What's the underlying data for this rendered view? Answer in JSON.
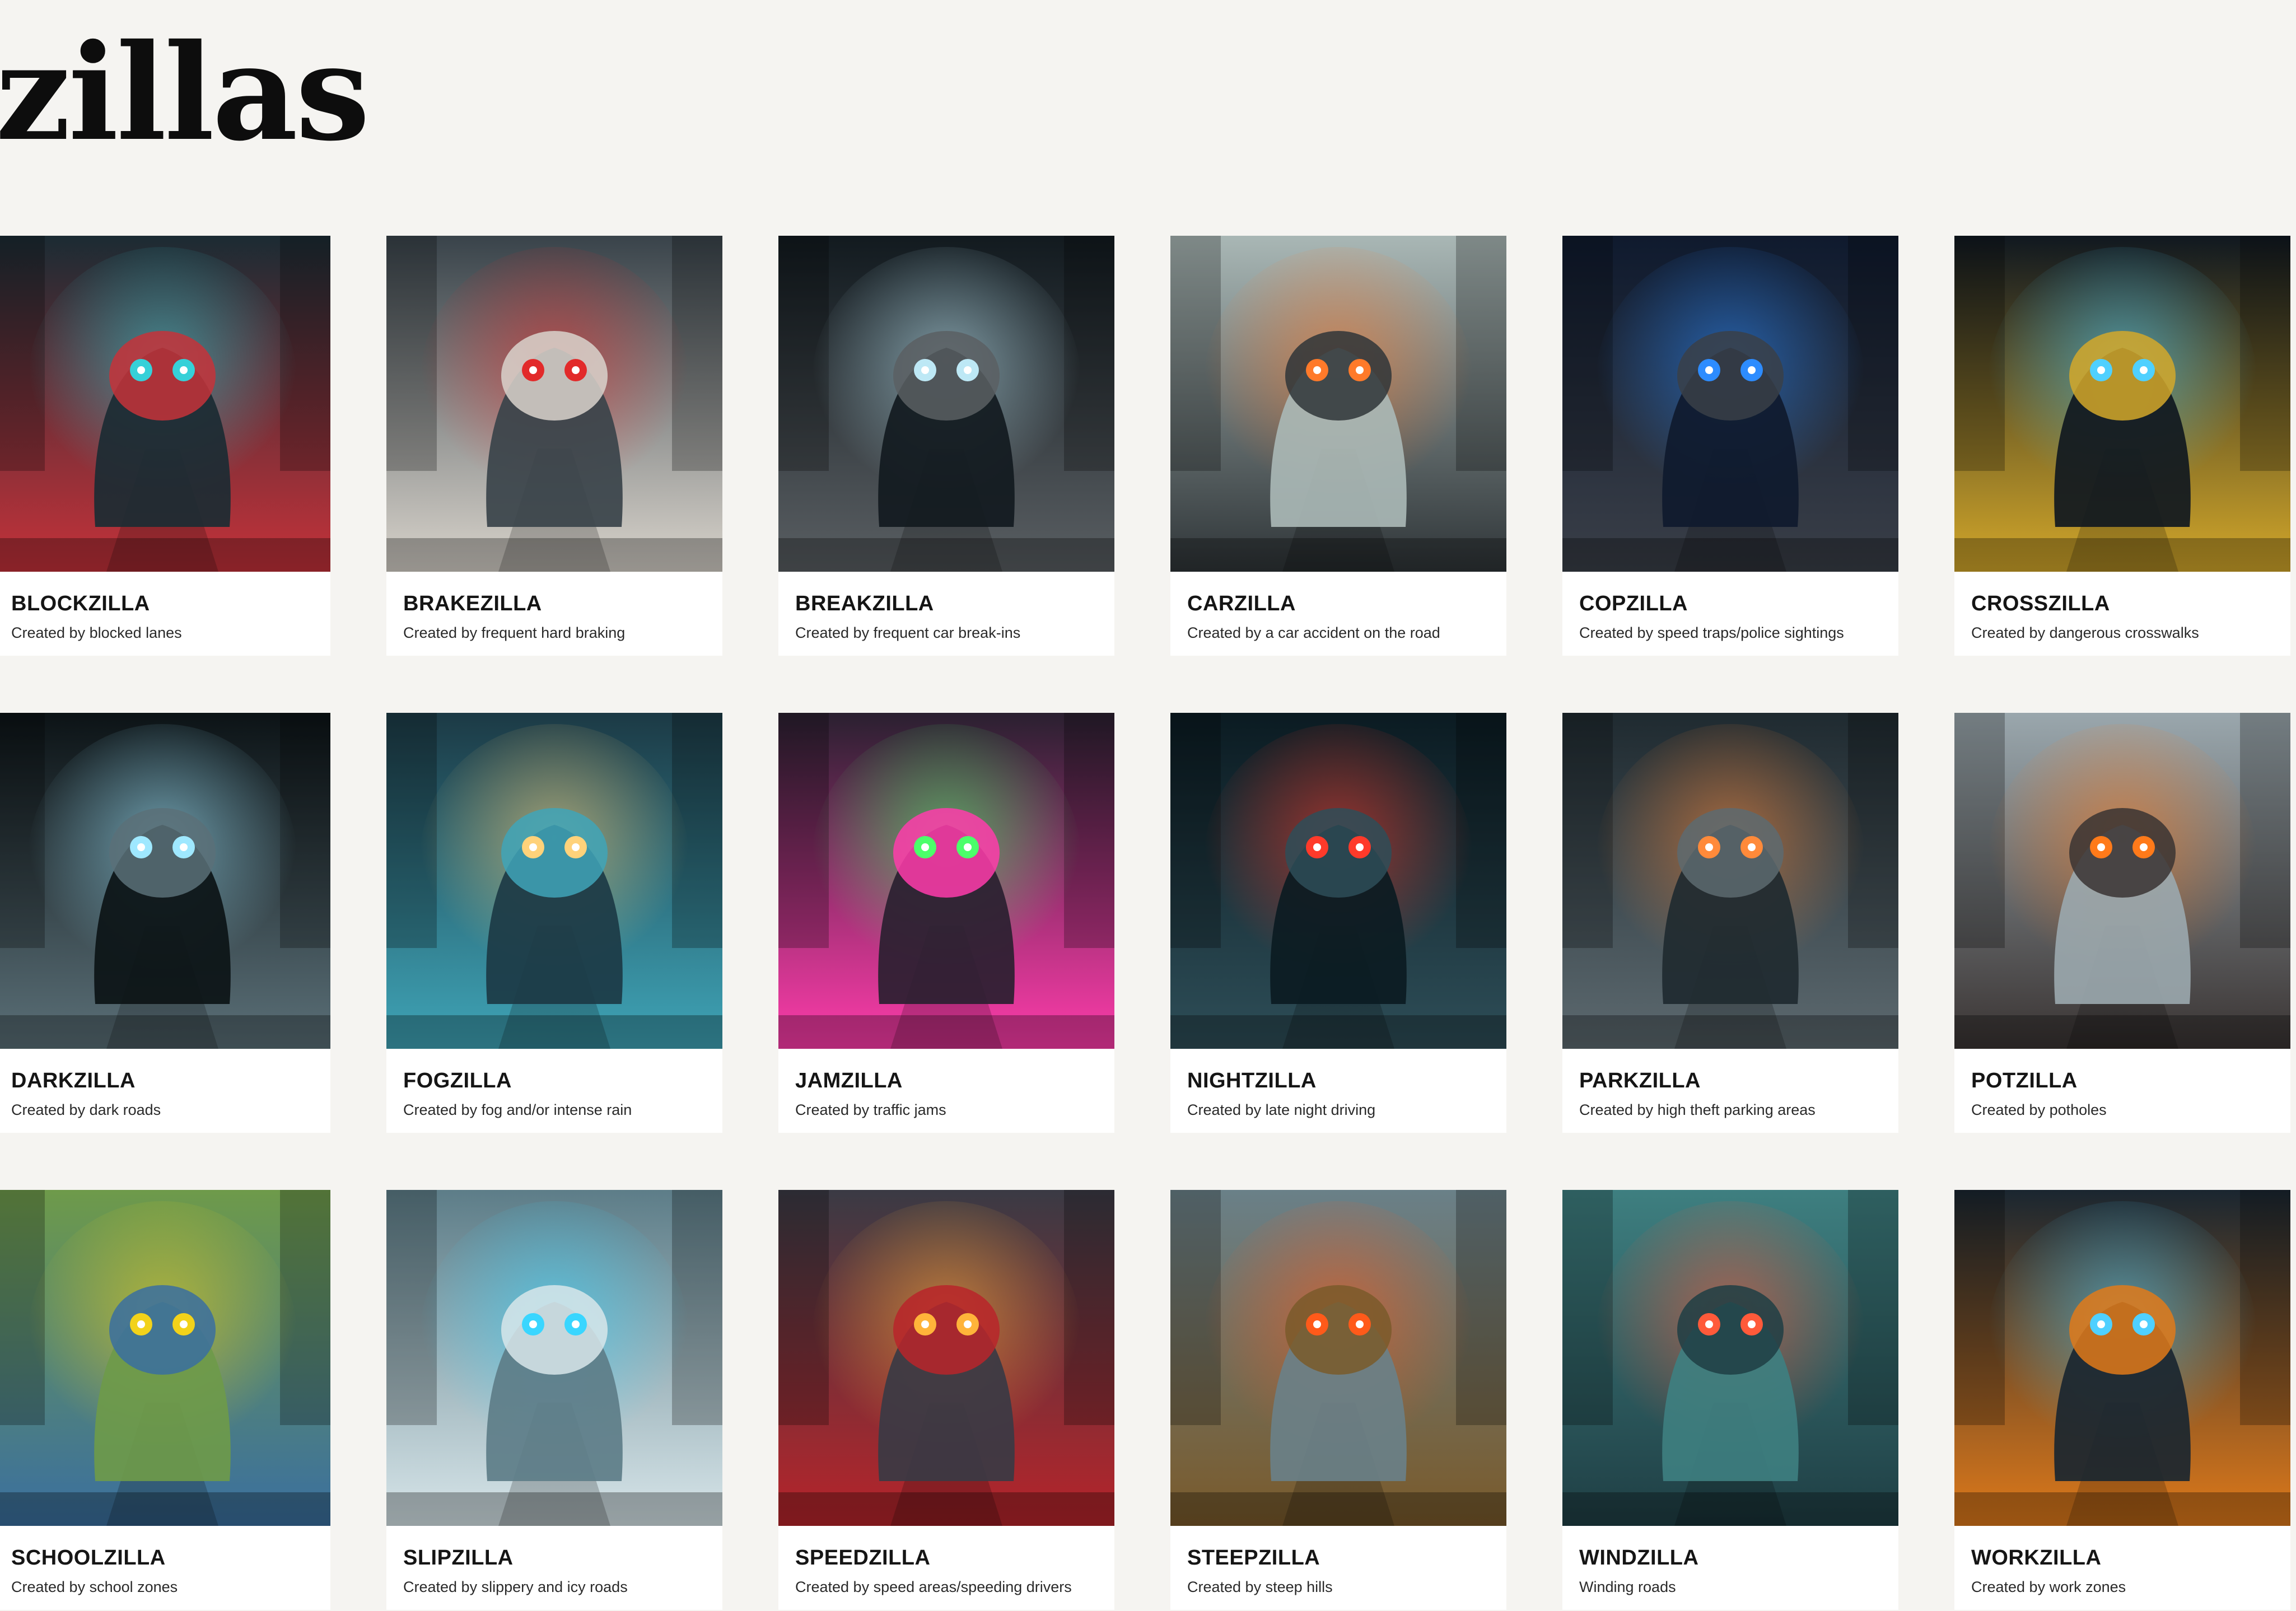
{
  "page": {
    "title": "zillas",
    "colors": {
      "background": "#f5f4f1",
      "card": "#ffffff",
      "text": "#151515"
    }
  },
  "cards": [
    {
      "name": "BLOCKZILLA",
      "description": "Created by blocked lanes",
      "icon": "blocked-traffic-monster-image",
      "palette": [
        "#1b2b33",
        "#c6323a",
        "#36d0d8"
      ]
    },
    {
      "name": "BRAKEZILLA",
      "description": "Created by frequent hard braking",
      "icon": "tire-monster-image",
      "palette": [
        "#39434a",
        "#d9d4cc",
        "#e22a2a"
      ]
    },
    {
      "name": "BREAKZILLA",
      "description": "Created by frequent car break-ins",
      "icon": "wreckage-monster-image",
      "palette": [
        "#121a1f",
        "#5a5f63",
        "#bde8f5"
      ]
    },
    {
      "name": "CARZILLA",
      "description": "Created by a car accident on the road",
      "icon": "car-wreck-monster-image",
      "palette": [
        "#a9b7b5",
        "#2f3538",
        "#ff7a2a"
      ]
    },
    {
      "name": "COPZILLA",
      "description": "Created by speed traps/police sightings",
      "icon": "police-robot-image",
      "palette": [
        "#0f1a2e",
        "#3a3f48",
        "#2d8cff"
      ]
    },
    {
      "name": "CROSSZILLA",
      "description": "Created by dangerous crosswalks",
      "icon": "crosswalk-monster-image",
      "palette": [
        "#101820",
        "#d4a82a",
        "#4fd0ff"
      ]
    },
    {
      "name": "DARKZILLA",
      "description": "Created by dark roads",
      "icon": "shadow-monster-image",
      "palette": [
        "#0c1316",
        "#5b7078",
        "#9fe8ff"
      ]
    },
    {
      "name": "FOGZILLA",
      "description": "Created by fog and/or intense rain",
      "icon": "fog-monster-image",
      "palette": [
        "#1c3a45",
        "#3fa5b8",
        "#ffd27a"
      ]
    },
    {
      "name": "JAMZILLA",
      "description": "Created by traffic jams",
      "icon": "traffic-light-monster-image",
      "palette": [
        "#2a2030",
        "#ff3cab",
        "#4bff6a"
      ]
    },
    {
      "name": "NIGHTZILLA",
      "description": "Created by late night driving",
      "icon": "night-creature-image",
      "palette": [
        "#0b1b22",
        "#2e4e58",
        "#ff3a2a"
      ]
    },
    {
      "name": "PARKZILLA",
      "description": "Created by high theft parking areas",
      "icon": "parking-monster-image",
      "palette": [
        "#1f2a30",
        "#5d6a70",
        "#ff8a3a"
      ]
    },
    {
      "name": "POTZILLA",
      "description": "Created by potholes",
      "icon": "pothole-monster-image",
      "palette": [
        "#9aa7ad",
        "#3a3433",
        "#ff7a1a"
      ]
    },
    {
      "name": "SCHOOLZILLA",
      "description": "Created by school zones",
      "icon": "school-zone-monster-image",
      "palette": [
        "#6e9a4a",
        "#3a6fa0",
        "#f2d21a"
      ]
    },
    {
      "name": "SLIPZILLA",
      "description": "Created by slippery and icy roads",
      "icon": "ice-monster-image",
      "palette": [
        "#5d7d88",
        "#d8e6ea",
        "#39d6ff"
      ]
    },
    {
      "name": "SPEEDZILLA",
      "description": "Created by speed areas/speeding drivers",
      "icon": "speed-monster-image",
      "palette": [
        "#3a3a44",
        "#b8242a",
        "#ffb43a"
      ]
    },
    {
      "name": "STEEPZILLA",
      "description": "Created by steep hills",
      "icon": "mountain-monster-image",
      "palette": [
        "#6a8088",
        "#7a5a2a",
        "#ff5a1a"
      ]
    },
    {
      "name": "WINDZILLA",
      "description": "Winding roads",
      "icon": "serpent-road-image",
      "palette": [
        "#3e7f80",
        "#1f3e44",
        "#ff5a3a"
      ]
    },
    {
      "name": "WORKZILLA",
      "description": "Created by work zones",
      "icon": "construction-robot-image",
      "palette": [
        "#1a2630",
        "#e07a1a",
        "#4fd0ff"
      ]
    }
  ]
}
